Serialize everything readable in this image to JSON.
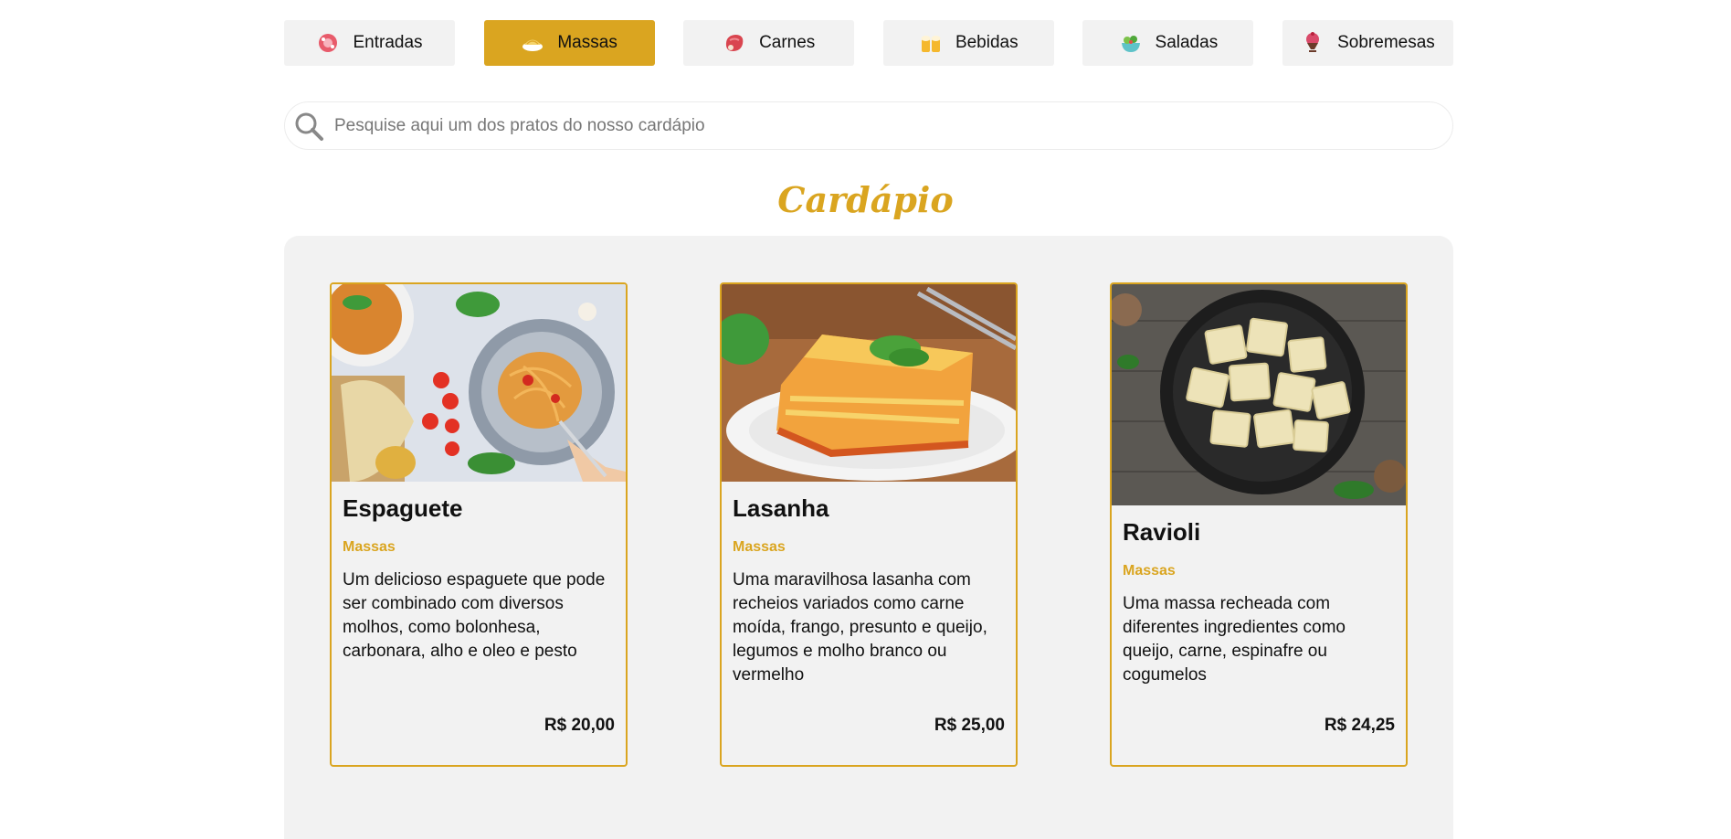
{
  "tabs": [
    {
      "label": "Entradas",
      "icon": "entrada-icon",
      "active": false
    },
    {
      "label": "Massas",
      "icon": "pasta-icon",
      "active": true
    },
    {
      "label": "Carnes",
      "icon": "meat-icon",
      "active": false
    },
    {
      "label": "Bebidas",
      "icon": "drinks-icon",
      "active": false
    },
    {
      "label": "Saladas",
      "icon": "salad-icon",
      "active": false
    },
    {
      "label": "Sobremesas",
      "icon": "dessert-icon",
      "active": false
    }
  ],
  "search": {
    "placeholder": "Pesquise aqui um dos pratos do nosso cardápio",
    "value": ""
  },
  "title": "Cardápio",
  "cards": [
    {
      "name": "Espaguete",
      "category": "Massas",
      "description": "Um delicioso espaguete que pode ser combinado com diversos molhos, como bolonhesa, carbonara, alho e oleo e pesto",
      "price": "R$ 20,00"
    },
    {
      "name": "Lasanha",
      "category": "Massas",
      "description": "Uma maravilhosa lasanha com recheios variados como carne moída, frango, presunto e queijo, legumos e molho branco ou vermelho",
      "price": "R$ 25,00"
    },
    {
      "name": "Ravioli",
      "category": "Massas",
      "description": "Uma massa recheada com diferentes ingredientes como queijo, carne, espinafre ou cogumelos",
      "price": "R$ 24,25"
    }
  ],
  "colors": {
    "accent": "#daa520",
    "panel": "#f2f2f2"
  }
}
